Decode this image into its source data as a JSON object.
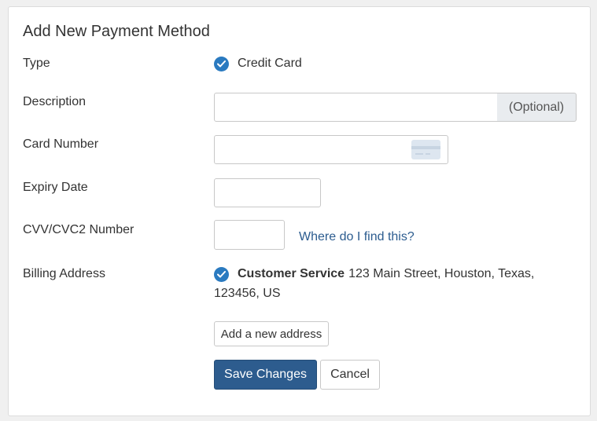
{
  "form": {
    "title": "Add New Payment Method",
    "labels": {
      "type": "Type",
      "description": "Description",
      "card_number": "Card Number",
      "expiry_date": "Expiry Date",
      "cvv": "CVV/CVC2 Number",
      "billing_address": "Billing Address"
    },
    "type_value": "Credit Card",
    "description": {
      "value": "",
      "addon": "(Optional)"
    },
    "card_number": {
      "value": ""
    },
    "expiry_date": {
      "value": ""
    },
    "cvv": {
      "value": "",
      "help_link": "Where do I find this?"
    },
    "billing_address": {
      "name": "Customer Service",
      "address_line1": "123 Main Street, Houston, Texas,",
      "address_line2": "123456, US"
    },
    "add_address_button": "Add a new address",
    "save_button": "Save Changes",
    "cancel_button": "Cancel"
  },
  "colors": {
    "accent": "#2a7ac0",
    "primary_button": "#2d5c8e",
    "link": "#2c5c8f"
  },
  "icons": {
    "type_check": "check-circle-icon",
    "address_check": "check-circle-icon",
    "card": "credit-card-icon"
  }
}
